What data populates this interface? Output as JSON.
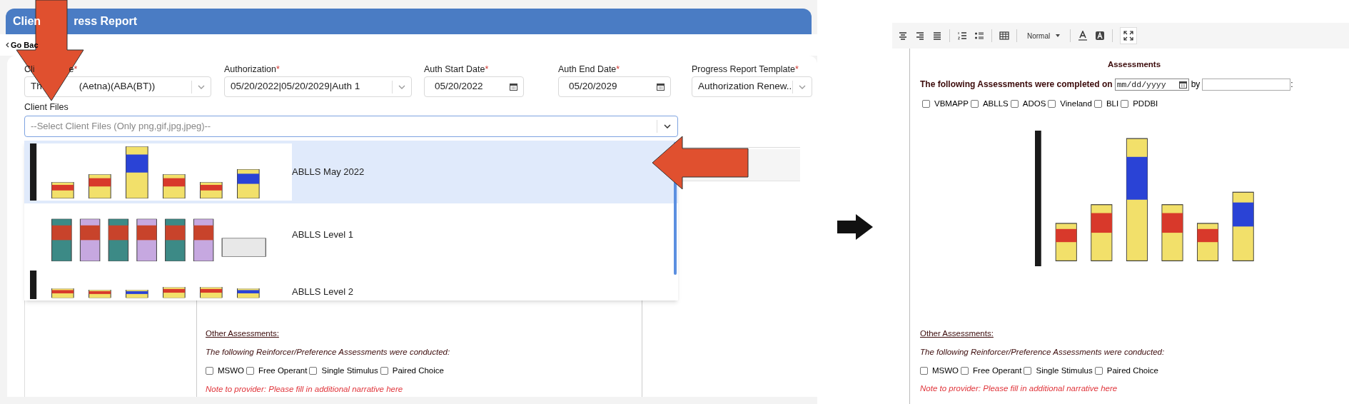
{
  "left_screen": {
    "header_title_parts": [
      "Clien",
      "ress Report"
    ],
    "back_link": "Go Bac",
    "fields": [
      {
        "kind": "select",
        "label_parts": [
          "Cli",
          "e"
        ],
        "required_mark": "*",
        "value_parts": [
          "Th",
          "(Aetna)(ABA(BT))"
        ]
      },
      {
        "kind": "select",
        "label_parts": [
          "Authorization"
        ],
        "required_mark": "*",
        "value_parts": [
          "05/20/2022|05/20/2029|Auth 1"
        ]
      },
      {
        "kind": "date",
        "label_parts": [
          "Auth Start Date"
        ],
        "required_mark": "*",
        "value_parts": [
          "05/20/2022"
        ]
      },
      {
        "kind": "date",
        "label_parts": [
          "Auth End Date"
        ],
        "required_mark": "*",
        "value_parts": [
          "05/20/2029"
        ]
      },
      {
        "kind": "select",
        "label_parts": [
          "Progress Report Template"
        ],
        "required_mark": "*",
        "value_parts": [
          "Authorization Renew..."
        ]
      }
    ],
    "client_files": {
      "label": "Client Files",
      "placeholder": "--Select Client Files (Only png,gif,jpg,jpeg)--",
      "open": true,
      "options": [
        {
          "label": "ABLLS May 2022",
          "selected": true
        },
        {
          "label": "ABLLS Level 1",
          "selected": false
        },
        {
          "label": "ABLLS Level 2",
          "selected": false
        }
      ]
    },
    "other_assessments": {
      "heading": "Other Assessments:",
      "intro": "The following Reinforcer/Preference Assessments were conducted:",
      "checkboxes": [
        {
          "label": "MSWO",
          "checked": false
        },
        {
          "label": "Free Operant",
          "checked": false
        },
        {
          "label": "Single Stimulus",
          "checked": false
        },
        {
          "label": "Paired Choice",
          "checked": false
        }
      ],
      "note": "Note to provider: Please fill in additional narrative here"
    }
  },
  "right_screen": {
    "toolbar": {
      "style_dropdown": "Normal"
    },
    "heading": "Assessments",
    "completed_sentence": "The following Assessments were completed on",
    "date_placeholder": "mm/dd/yyyy",
    "by_label": "by",
    "colon": ":",
    "checkboxes": [
      {
        "label": "VBMAPP",
        "checked": false
      },
      {
        "label": "ABLLS",
        "checked": false
      },
      {
        "label": "ADOS",
        "checked": false
      },
      {
        "label": "Vineland",
        "checked": false
      },
      {
        "label": "BLI",
        "checked": false
      },
      {
        "label": "PDDBI",
        "checked": false
      }
    ],
    "other_assessments": {
      "heading": "Other Assessments:",
      "intro": "The following Reinforcer/Preference Assessments were conducted:",
      "checkboxes": [
        {
          "label": "MSWO",
          "checked": false
        },
        {
          "label": "Free Operant",
          "checked": false
        },
        {
          "label": "Single Stimulus",
          "checked": false
        },
        {
          "label": "Paired Choice",
          "checked": false
        }
      ],
      "note": "Note to provider: Please fill in additional narrative here"
    }
  }
}
